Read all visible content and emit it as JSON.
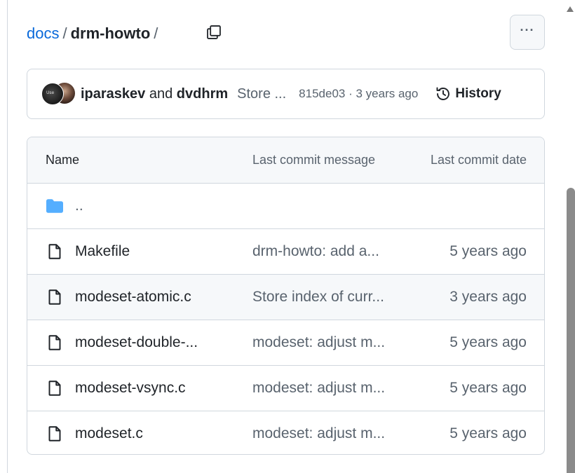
{
  "breadcrumb": {
    "root": "docs",
    "separator": "/",
    "current": "drm-howto",
    "trailing_separator": "/"
  },
  "icons": {
    "copy": "copy-icon",
    "more": "kebab-horizontal-icon",
    "history": "history-icon",
    "folder": "folder-icon",
    "file": "file-icon"
  },
  "more_button_label": "···",
  "commit": {
    "author1": "iparaskev",
    "conjunction": "and",
    "author2": "dvdhrm",
    "message": "Store ...",
    "hash": "815de03",
    "separator": "·",
    "time": "3 years ago",
    "history_label": "History"
  },
  "table": {
    "headers": {
      "name": "Name",
      "message": "Last commit message",
      "date": "Last commit date"
    },
    "parent_dir": "..",
    "rows": [
      {
        "name": "Makefile",
        "message": "drm-howto: add a...",
        "date": "5 years ago"
      },
      {
        "name": "modeset-atomic.c",
        "message": "Store index of curr...",
        "date": "3 years ago"
      },
      {
        "name": "modeset-double-...",
        "message": "modeset: adjust m...",
        "date": "5 years ago"
      },
      {
        "name": "modeset-vsync.c",
        "message": "modeset: adjust m...",
        "date": "5 years ago"
      },
      {
        "name": "modeset.c",
        "message": "modeset: adjust m...",
        "date": "5 years ago"
      }
    ],
    "hover_row": 1
  },
  "colors": {
    "link": "#0969da",
    "text": "#1f2328",
    "muted": "#59636e",
    "border": "#d0d7de",
    "folder": "#54aeff",
    "header_bg": "#f6f8fa"
  }
}
